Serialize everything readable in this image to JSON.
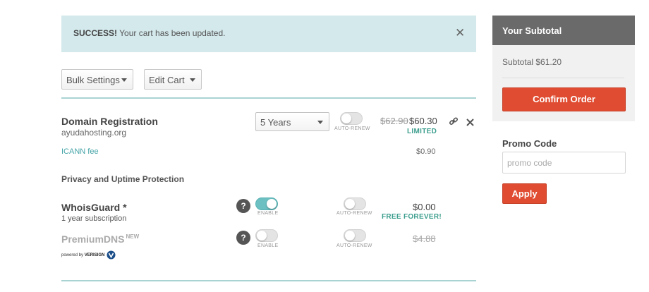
{
  "alert": {
    "strong": "SUCCESS!",
    "message": "Your cart has been updated.",
    "close_glyph": "✕"
  },
  "toolbar": {
    "bulk_settings_label": "Bulk Settings",
    "edit_cart_label": "Edit Cart"
  },
  "domain": {
    "title": "Domain Registration",
    "name": "ayudahosting.org",
    "duration_selected": "5 Years",
    "auto_renew_label": "AUTO-RENEW",
    "auto_renew_on": false,
    "old_price": "$62.90",
    "price": "$60.30",
    "badge": "LIMITED",
    "icann_label": "ICANN fee",
    "icann_price": "$0.90"
  },
  "privacy": {
    "section_title": "Privacy and Uptime Protection",
    "whoisguard": {
      "title": "WhoisGuard *",
      "subtitle": "1 year subscription",
      "help": "?",
      "enable_label": "ENABLE",
      "enabled": true,
      "auto_renew_label": "AUTO-RENEW",
      "auto_renew_on": false,
      "price": "$0.00",
      "badge": "FREE FOREVER!"
    },
    "premiumdns": {
      "title": "PremiumDNS",
      "new_tag": "NEW",
      "powered_by": "powered by",
      "verisign": "VERISIGN",
      "help": "?",
      "enable_label": "ENABLE",
      "enabled": false,
      "auto_renew_label": "AUTO-RENEW",
      "auto_renew_on": false,
      "price": "$4.88"
    }
  },
  "sidebar": {
    "title": "Your Subtotal",
    "subtotal": "Subtotal $61.20",
    "confirm_label": "Confirm Order"
  },
  "promo": {
    "label": "Promo Code",
    "placeholder": "promo code",
    "value": "",
    "apply_label": "Apply"
  },
  "colors": {
    "alert_bg": "#d4e9ec",
    "accent_teal": "#43a3a6",
    "free_green": "#3c9e8d",
    "confirm_red": "#e04c31",
    "sidebar_header": "#6a6a6a"
  },
  "icons": [
    "close-icon",
    "chevron-down-icon",
    "link-icon",
    "remove-icon",
    "help-icon",
    "verisign-logo-icon"
  ]
}
